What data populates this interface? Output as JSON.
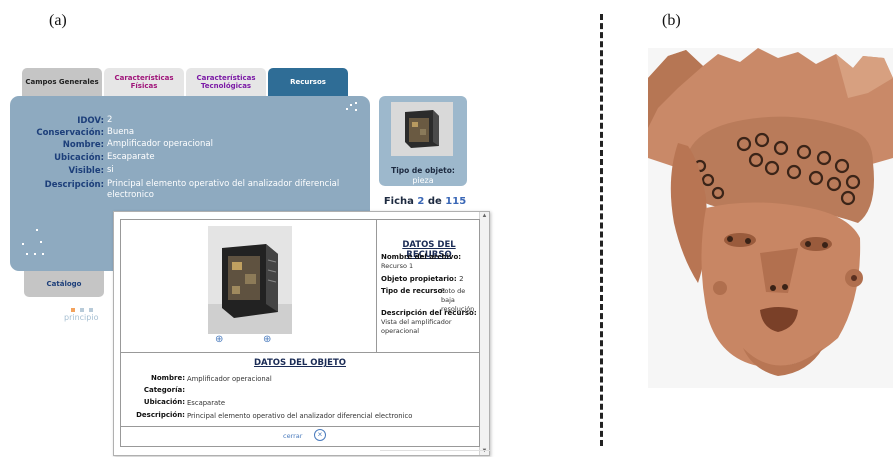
{
  "panel_labels": {
    "a": "(a)",
    "b": "(b)"
  },
  "tabs": {
    "general": "Campos Generales",
    "fisicas_1": "Características",
    "fisicas_2": "Físicas",
    "tecno_1": "Características",
    "tecno_2": "Tecnológicas",
    "recursos": "Recursos"
  },
  "fields": {
    "idov": {
      "label": "IDOV:",
      "value": "2"
    },
    "conservacion": {
      "label": "Conservación:",
      "value": "Buena"
    },
    "nombre": {
      "label": "Nombre:",
      "value": "Amplificador operacional"
    },
    "ubicacion": {
      "label": "Ubicación:",
      "value": "Escaparate"
    },
    "visible": {
      "label": "Visible:",
      "value": "si"
    },
    "descripcion": {
      "label": "Descripción:",
      "value_1": "Principal elemento operativo del analizador diferencial",
      "value_2": "electronico"
    }
  },
  "catalog_tab": "Catálogo",
  "principio": "principio",
  "thumb": {
    "tipo_label": "Tipo de objeto:",
    "tipo_value": "pieza"
  },
  "ficha": {
    "prefix": "Ficha",
    "current": "2",
    "sep": "de",
    "total": "115"
  },
  "popup": {
    "recurso_title": "DATOS DEL RECURSO",
    "archivo_label": "Nombre del archivo:",
    "archivo_value": "Recurso 1",
    "propietario_label": "Objeto propietario:",
    "propietario_value": "2",
    "tipo_label": "Tipo de recurso:",
    "tipo_value": "Foto de baja resolución",
    "descripcion_label": "Descripción del recurso:",
    "descripcion_value": "Vista del amplificador operacional",
    "objeto_title": "DATOS DEL OBJETO",
    "obj_nombre_label": "Nombre:",
    "obj_nombre_value": "Amplificador operacional",
    "obj_categoria_label": "Categoría:",
    "obj_categoria_value": "",
    "obj_ubicacion_label": "Ubicación:",
    "obj_ubicacion_value": "Escaparate",
    "obj_descripcion_label": "Descripción:",
    "obj_descripcion_value": "Principal elemento operativo del analizador diferencial electronico",
    "close_label": "cerrar"
  },
  "colors": {
    "panel_blue": "#8eaac0",
    "tab_active": "#2f6d96",
    "label_navy": "#1d3f7a",
    "link_blue": "#4a7bbd",
    "clay": "#c98a68"
  },
  "icons": [
    "zoom-in-icon",
    "zoom-out-icon",
    "close-circle-icon"
  ]
}
